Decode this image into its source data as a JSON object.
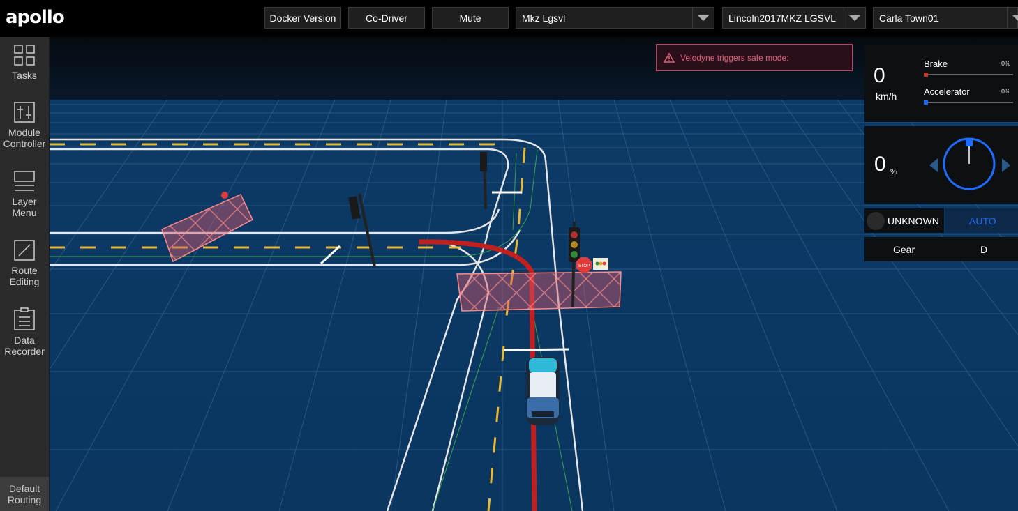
{
  "app": {
    "logo": "apollo"
  },
  "toolbar": {
    "docker_label": "Docker Version",
    "codriver_label": "Co-Driver",
    "mute_label": "Mute",
    "mode_select": "Mkz Lgsvl",
    "vehicle_select": "Lincoln2017MKZ LGSVL",
    "map_select": "Carla Town01"
  },
  "sidebar": {
    "items": [
      {
        "label1": "Tasks",
        "label2": ""
      },
      {
        "label1": "Module",
        "label2": "Controller"
      },
      {
        "label1": "Layer",
        "label2": "Menu"
      },
      {
        "label1": "Route",
        "label2": "Editing"
      },
      {
        "label1": "Data",
        "label2": "Recorder"
      }
    ],
    "default_routing": {
      "label1": "Default",
      "label2": "Routing"
    }
  },
  "alert": {
    "text": "Velodyne triggers safe mode:"
  },
  "dashboard": {
    "speed": "0",
    "speed_unit": "km/h",
    "brake_label": "Brake",
    "brake_value": "0%",
    "accelerator_label": "Accelerator",
    "accelerator_value": "0%",
    "steering_value": "0",
    "steering_unit": "%",
    "driving_mode": "UNKNOWN",
    "auto_label": "AUTO",
    "gear_label": "Gear",
    "gear_value": "D"
  },
  "colors": {
    "accent": "#1e6bff",
    "alert": "#e0607a",
    "brake": "#c0392b",
    "scene_bg": "#0b3a63"
  },
  "scene_signs": {
    "stop": "STOP"
  }
}
